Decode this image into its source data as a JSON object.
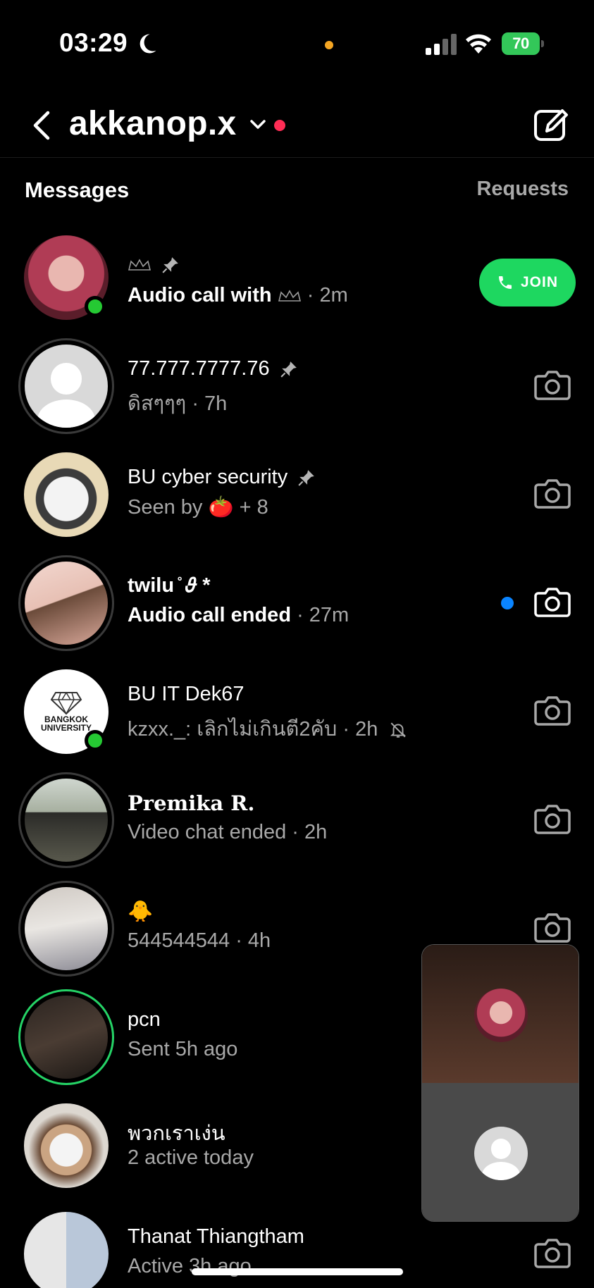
{
  "status_bar": {
    "time": "03:29",
    "battery": "70"
  },
  "header": {
    "account_name": "akkanop.x"
  },
  "tabs": {
    "messages": "Messages",
    "requests": "Requests"
  },
  "conversations": [
    {
      "name": "",
      "subtitle": "Audio call with",
      "time": " · 2m",
      "pinned": true,
      "action": "JOIN"
    },
    {
      "name": "77.777.7777.76",
      "subtitle": "ดิสๆๆๆ",
      "time": " · 7h",
      "pinned": true
    },
    {
      "name": "BU cyber security",
      "subtitle": "Seen by 🍅 + 8",
      "pinned": true
    },
    {
      "name": "twilu ̊ 𝜗 *",
      "subtitle": "Audio call ended",
      "time": " · 27m",
      "unread": true
    },
    {
      "name": "BU IT Dek67",
      "subtitle": "kzxx._: เลิกไม่เกินตี2คับ",
      "time": " · 2h",
      "muted": true
    },
    {
      "name": "𝐏𝐫𝐞𝐦𝐢𝐤𝐚 𝐑.",
      "subtitle": "Video chat ended",
      "time": " · 2h"
    },
    {
      "name": "🐥",
      "subtitle": "544544544",
      "time": " · 4h"
    },
    {
      "name": "pcn",
      "subtitle": "Sent 5h ago"
    },
    {
      "name": "พวกเราเง่น",
      "subtitle": "2 active today"
    },
    {
      "name": "Thanat Thiangtham",
      "subtitle": "Active 3h ago"
    }
  ],
  "bu_logo_text": {
    "line1": "BANGKOK",
    "line2": "UNIVERSITY"
  },
  "colors": {
    "accent_green": "#1ed760",
    "unread_blue": "#0a84ff",
    "notification_red": "#ff2d55"
  }
}
